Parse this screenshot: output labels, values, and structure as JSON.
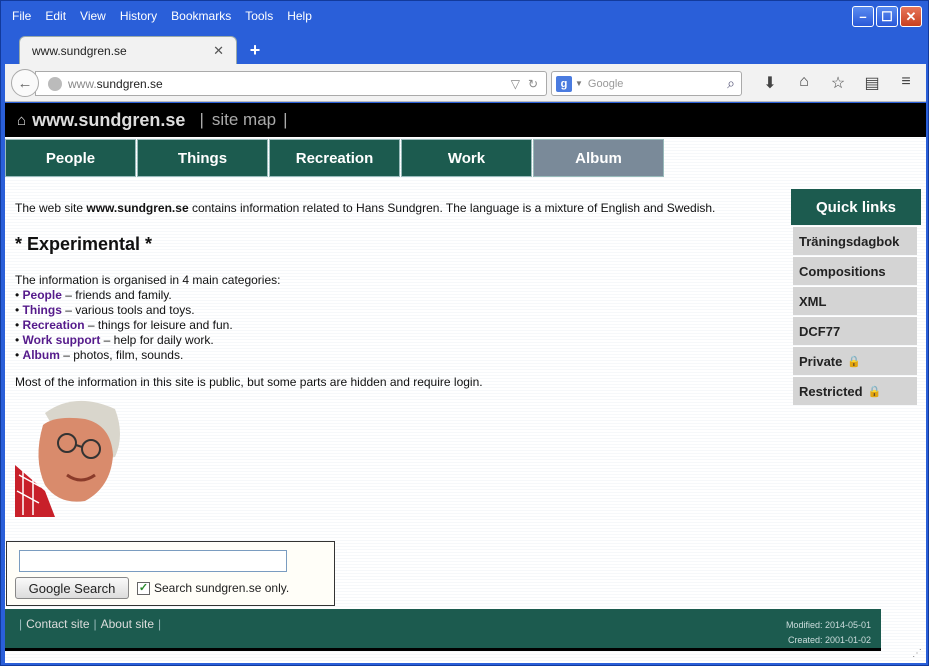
{
  "menu": [
    "File",
    "Edit",
    "View",
    "History",
    "Bookmarks",
    "Tools",
    "Help"
  ],
  "tab": {
    "title": "www.sundgren.se"
  },
  "url": {
    "prefix": "www.",
    "domain": "sundgren.se"
  },
  "search": {
    "placeholder": "Google",
    "engine": "g"
  },
  "site": {
    "name": "www.sundgren.se",
    "sitemap": "site map",
    "sep": "|"
  },
  "nav": [
    "People",
    "Things",
    "Recreation",
    "Work",
    "Album"
  ],
  "intro": {
    "before": "The web site ",
    "bold": "www.sundgren.se",
    "after": " contains information related to Hans Sundgren. The language is a mixture of English and Swedish."
  },
  "heading": "* Experimental *",
  "catIntro": "The information is organised in 4 main categories:",
  "categories": [
    {
      "name": "People",
      "desc": " – friends and family."
    },
    {
      "name": "Things",
      "desc": " – various tools and toys."
    },
    {
      "name": "Recreation",
      "desc": " – things for leisure and fun."
    },
    {
      "name": "Work support",
      "desc": " – help for daily work."
    },
    {
      "name": "Album",
      "desc": " – photos, film, sounds."
    }
  ],
  "publicNote": "Most of the information in this site is public, but some parts are hidden and require login.",
  "quicklinks": {
    "title": "Quick links",
    "items": [
      "Träningsdagbok",
      "Compositions",
      "XML",
      "DCF77",
      "Private",
      "Restricted"
    ]
  },
  "googleSearch": {
    "button": "Google Search",
    "checkLabel": "Search sundgren.se only.",
    "checked": true
  },
  "footer": {
    "contact": "Contact site",
    "about": "About site",
    "modified": "Modified: 2014-05-01",
    "created": "Created: 2001-01-02"
  },
  "colors": {
    "brand_green": "#1c5b4f",
    "album_tab": "#7a8a99",
    "link": "#551a8b",
    "window_blue": "#2a5fd9"
  }
}
